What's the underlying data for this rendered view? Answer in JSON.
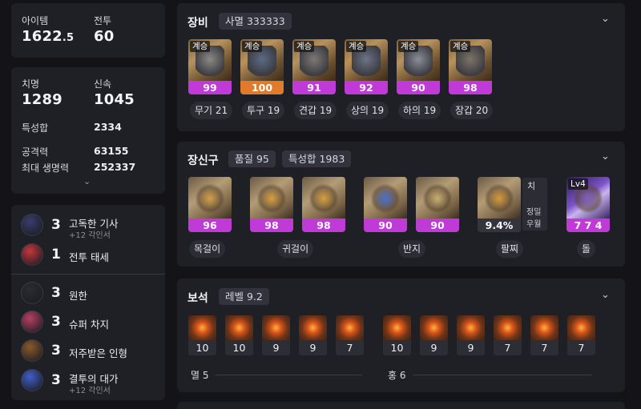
{
  "left": {
    "summary": {
      "item_label": "아이템",
      "item_value": "1622",
      "item_decimal": ".5",
      "battle_label": "전투",
      "battle_value": "60"
    },
    "stats": {
      "crit_label": "치명",
      "crit_value": "1289",
      "swift_label": "신속",
      "swift_value": "1045",
      "spec_total_label": "특성합",
      "spec_total_value": "2334",
      "attack_label": "공격력",
      "attack_value": "63155",
      "hp_label": "최대 생명력",
      "hp_value": "252337",
      "expand_icon": "chevron-down-icon"
    },
    "engravings_top": [
      {
        "level": "3",
        "name": "고독한 기사",
        "sub": "+12 각인서",
        "icon": "lone-knight-icon",
        "color": "#3a3d6e"
      },
      {
        "level": "1",
        "name": "전투 태세",
        "sub": "",
        "icon": "battle-stance-icon",
        "color": "#c4373c"
      }
    ],
    "engravings_bottom": [
      {
        "level": "3",
        "name": "원한",
        "sub": "",
        "icon": "grudge-icon",
        "color": "#2b2b31"
      },
      {
        "level": "3",
        "name": "슈퍼 차지",
        "sub": "",
        "icon": "super-charge-icon",
        "color": "#b74062"
      },
      {
        "level": "3",
        "name": "저주받은 인형",
        "sub": "",
        "icon": "cursed-doll-icon",
        "color": "#8a5a2c"
      },
      {
        "level": "3",
        "name": "결투의 대가",
        "sub": "+12 각인서",
        "icon": "master-brawler-icon",
        "color": "#3f5fc8"
      }
    ]
  },
  "equipment": {
    "title": "장비",
    "chip": "사멸 333333",
    "items": [
      {
        "tag": "계승",
        "quality": "99",
        "label": "무기 21",
        "bar": "purple",
        "icon": "weapon-icon"
      },
      {
        "tag": "계승",
        "quality": "100",
        "label": "투구 19",
        "bar": "orange",
        "icon": "helmet-icon"
      },
      {
        "tag": "계승",
        "quality": "91",
        "label": "견갑 19",
        "bar": "purple",
        "icon": "shoulder-icon"
      },
      {
        "tag": "계승",
        "quality": "92",
        "label": "상의 19",
        "bar": "purple",
        "icon": "chest-icon"
      },
      {
        "tag": "계승",
        "quality": "90",
        "label": "하의 19",
        "bar": "purple",
        "icon": "pants-icon"
      },
      {
        "tag": "계승",
        "quality": "98",
        "label": "장갑 20",
        "bar": "purple",
        "icon": "gloves-icon"
      }
    ]
  },
  "accessories": {
    "title": "장신구",
    "chip_quality": "품질 95",
    "chip_spec": "특성합 1983",
    "items": [
      {
        "quality": "96",
        "icon": "necklace-icon"
      },
      {
        "quality": "98",
        "icon": "earring-icon"
      },
      {
        "quality": "98",
        "icon": "earring-icon"
      },
      {
        "quality": "90",
        "icon": "ring-icon"
      },
      {
        "quality": "90",
        "icon": "ring-icon"
      },
      {
        "quality": "9.4%",
        "icon": "bracelet-icon"
      },
      {
        "quality": "7 7 4",
        "icon": "ability-stone-icon",
        "tag": "Lv4"
      }
    ],
    "bracelet_side": {
      "line1": "치",
      "line2": "정밀",
      "line3": "우월"
    },
    "labels": {
      "necklace": "목걸이",
      "earring": "귀걸이",
      "ring": "반지",
      "bracelet": "팔찌",
      "stone": "돌"
    }
  },
  "gems": {
    "title": "보석",
    "chip": "레벨 9.2",
    "annihilation": [
      "10",
      "10",
      "9",
      "9",
      "7"
    ],
    "crimson": [
      "10",
      "9",
      "9",
      "7",
      "7",
      "7"
    ],
    "annihilation_label": "멸 5",
    "crimson_label": "홍 6"
  },
  "colors": {
    "purple": "#c03ad8",
    "orange": "#e07b2b",
    "panel": "#1f1f26",
    "background": "#131318"
  }
}
